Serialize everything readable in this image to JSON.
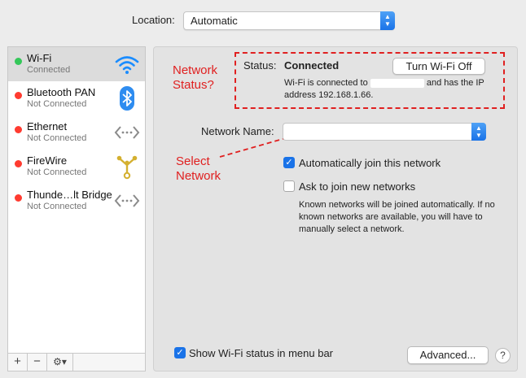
{
  "location": {
    "label": "Location:",
    "value": "Automatic"
  },
  "sidebar": {
    "services": [
      {
        "name": "Wi-Fi",
        "status": "Connected",
        "dot_color": "#34c759",
        "icon": "wifi-icon",
        "selected": true
      },
      {
        "name": "Bluetooth PAN",
        "status": "Not Connected",
        "dot_color": "#ff3b30",
        "icon": "bluetooth-icon"
      },
      {
        "name": "Ethernet",
        "status": "Not Connected",
        "dot_color": "#ff3b30",
        "icon": "ethernet-icon"
      },
      {
        "name": "FireWire",
        "status": "Not Connected",
        "dot_color": "#ff3b30",
        "icon": "firewire-icon"
      },
      {
        "name": "Thunde…lt Bridge",
        "status": "Not Connected",
        "dot_color": "#ff3b30",
        "icon": "thunderbolt-bridge-icon"
      }
    ],
    "toolbar": {
      "add": "+",
      "remove": "−",
      "action": "⚙▾"
    }
  },
  "status": {
    "label": "Status:",
    "value": "Connected",
    "desc_before": "Wi-Fi is connected to",
    "desc_after": "and has the IP address 192.168.1.66.",
    "button": "Turn Wi-Fi Off"
  },
  "annotations": {
    "network_status_line1": "Network",
    "network_status_line2": "Status?",
    "select_network_line1": "Select",
    "select_network_line2": "Network"
  },
  "network_name": {
    "label": "Network Name:",
    "value": ""
  },
  "options": {
    "auto_join": "Automatically join this network",
    "ask_join": "Ask to join new networks",
    "ask_join_desc": "Known networks will be joined automatically. If no known networks are available, you will have to manually select a network."
  },
  "footer": {
    "show_status": "Show Wi-Fi status in menu bar",
    "advanced": "Advanced...",
    "help": "?"
  },
  "colors": {
    "accent": "#1a73e8",
    "annotation": "#e02020",
    "connected": "#34c759",
    "disconnected": "#ff3b30"
  }
}
